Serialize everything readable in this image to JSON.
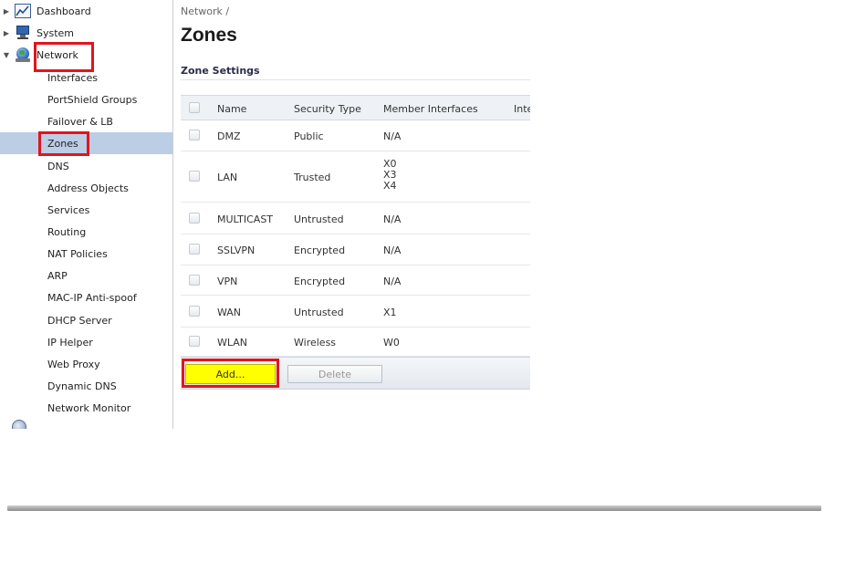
{
  "sidebar": {
    "top_items": [
      {
        "label": "Dashboard",
        "icon": "dashboard-icon",
        "expander": "▶"
      },
      {
        "label": "System",
        "icon": "monitor-icon",
        "expander": "▶"
      },
      {
        "label": "Network",
        "icon": "globe-icon",
        "expander": "▼"
      }
    ],
    "network_items": [
      {
        "label": "Interfaces"
      },
      {
        "label": "PortShield Groups"
      },
      {
        "label": "Failover & LB"
      },
      {
        "label": "Zones",
        "selected": true
      },
      {
        "label": "DNS"
      },
      {
        "label": "Address Objects"
      },
      {
        "label": "Services"
      },
      {
        "label": "Routing"
      },
      {
        "label": "NAT Policies"
      },
      {
        "label": "ARP"
      },
      {
        "label": "MAC-IP Anti-spoof"
      },
      {
        "label": "DHCP Server"
      },
      {
        "label": "IP Helper"
      },
      {
        "label": "Web Proxy"
      },
      {
        "label": "Dynamic DNS"
      },
      {
        "label": "Network Monitor"
      }
    ]
  },
  "main": {
    "breadcrumb": "Network /",
    "title": "Zones",
    "section_title": "Zone Settings",
    "table": {
      "headers": [
        "Name",
        "Security Type",
        "Member Interfaces",
        "Inte"
      ],
      "rows": [
        {
          "name": "DMZ",
          "security_type": "Public",
          "members": [
            "N/A"
          ]
        },
        {
          "name": "LAN",
          "security_type": "Trusted",
          "members": [
            "X0",
            "X3",
            "X4"
          ]
        },
        {
          "name": "MULTICAST",
          "security_type": "Untrusted",
          "members": [
            "N/A"
          ]
        },
        {
          "name": "SSLVPN",
          "security_type": "Encrypted",
          "members": [
            "N/A"
          ]
        },
        {
          "name": "VPN",
          "security_type": "Encrypted",
          "members": [
            "N/A"
          ]
        },
        {
          "name": "WAN",
          "security_type": "Untrusted",
          "members": [
            "X1"
          ]
        },
        {
          "name": "WLAN",
          "security_type": "Wireless",
          "members": [
            "W0"
          ]
        }
      ]
    },
    "buttons": {
      "add": "Add...",
      "delete": "Delete"
    }
  },
  "colors": {
    "highlight_box": "#e0151e",
    "add_button": "#ffff00",
    "selected_nav": "#bccde6"
  }
}
